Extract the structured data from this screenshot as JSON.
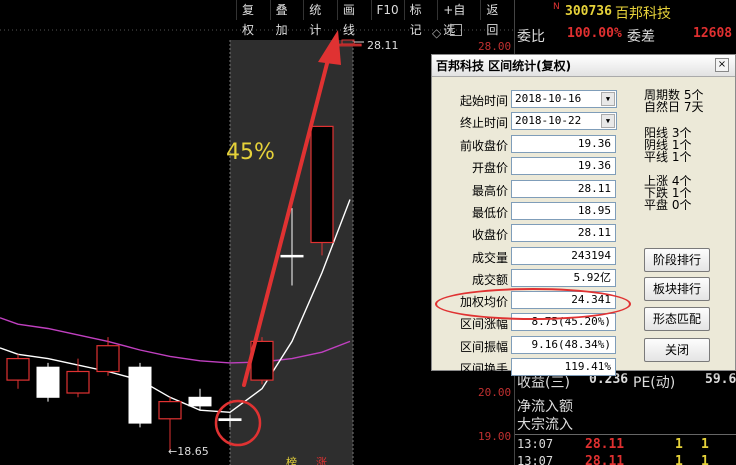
{
  "toolbar": [
    {
      "label": "复权"
    },
    {
      "label": "叠加"
    },
    {
      "label": "统计"
    },
    {
      "label": "画线"
    },
    {
      "label": "F10"
    },
    {
      "label": "标记"
    },
    {
      "label": "+自选"
    },
    {
      "label": "返回"
    }
  ],
  "chart": {
    "price_axis": [
      "28.00",
      "20.00",
      "19.00"
    ],
    "gain_annotation": "45%",
    "high_marker": "28.11",
    "low_marker": "←18.65",
    "bottom_tag_1": "榜",
    "bottom_tag_2": "涨",
    "candles": [
      {
        "open": 20.3,
        "close": 20.8,
        "high": 20.9,
        "low": 20.1,
        "up": true
      },
      {
        "open": 20.6,
        "close": 19.9,
        "high": 20.7,
        "low": 19.8,
        "up": false
      },
      {
        "open": 20.0,
        "close": 20.5,
        "high": 20.8,
        "low": 19.9,
        "up": true
      },
      {
        "open": 20.5,
        "close": 21.1,
        "high": 21.3,
        "low": 20.4,
        "up": true
      },
      {
        "open": 20.6,
        "close": 19.3,
        "high": 20.7,
        "low": 19.2,
        "up": false
      },
      {
        "open": 19.4,
        "close": 19.8,
        "high": 19.9,
        "low": 18.65,
        "up": true
      },
      {
        "open": 19.9,
        "close": 19.7,
        "high": 20.1,
        "low": 19.6,
        "up": false
      },
      {
        "open": 19.4,
        "close": 19.36,
        "high": 19.5,
        "low": 19.2,
        "up": false
      },
      {
        "open": 20.3,
        "close": 21.2,
        "high": 21.3,
        "low": 20.2,
        "up": true
      },
      {
        "open": 23.2,
        "close": 23.2,
        "high": 24.3,
        "low": 22.5,
        "up": false
      },
      {
        "open": 23.5,
        "close": 26.2,
        "high": 26.2,
        "low": 23.2,
        "up": true
      },
      {
        "open": 28.11,
        "close": 28.11,
        "high": 28.11,
        "low": 28.11,
        "up": true
      }
    ],
    "ma_purple": [
      21.6,
      21.5,
      21.35,
      21.2,
      21.0,
      20.85,
      20.75,
      20.7,
      20.72,
      20.8,
      20.95,
      21.2
    ],
    "ma_white": [
      20.9,
      20.8,
      20.65,
      20.5,
      20.3,
      19.9,
      19.6,
      19.55,
      20.1,
      21.2,
      22.8,
      24.5
    ],
    "colors": {
      "up": "#e03232",
      "down": "#ffffff",
      "ma_purple": "#c040c0",
      "arrow": "#e03232"
    }
  },
  "quote": {
    "marker": "N",
    "code": "300736",
    "name": "百邦科技",
    "wb_label": "委比",
    "wb_value": "100.00%",
    "wc_label": "委差",
    "wc_value": "12608",
    "rows": [
      {
        "k": "收益(三)",
        "v1": "0.236",
        "k2": "PE(动)",
        "v2": "59.6"
      },
      {
        "k": "净流入额",
        "v1": "",
        "k2": "",
        "v2": ""
      },
      {
        "k": "大宗流入",
        "v1": "",
        "k2": "",
        "v2": ""
      }
    ],
    "ticks": [
      {
        "time": "13:07",
        "price": "28.11",
        "vol": "1",
        "n": "1"
      },
      {
        "time": "13:07",
        "price": "28.11",
        "vol": "1",
        "n": "1"
      }
    ]
  },
  "dialog": {
    "title": "百邦科技 区间统计(复权)",
    "close": "×",
    "start_label": "起始时间",
    "start_value": "2018-10-16",
    "end_label": "终止时间",
    "end_value": "2018-10-22",
    "fields": [
      {
        "label": "前收盘价",
        "value": "19.36"
      },
      {
        "label": "开盘价",
        "value": "19.36"
      },
      {
        "label": "最高价",
        "value": "28.11"
      },
      {
        "label": "最低价",
        "value": "18.95"
      },
      {
        "label": "收盘价",
        "value": "28.11"
      },
      {
        "label": "成交量",
        "value": "243194"
      },
      {
        "label": "成交额",
        "value": "5.92亿"
      },
      {
        "label": "加权均价",
        "value": "24.341"
      },
      {
        "label": "区间涨幅",
        "value": "8.75(45.20%)"
      },
      {
        "label": "区间振幅",
        "value": "9.16(48.34%)"
      },
      {
        "label": "区间换手",
        "value": "119.41%"
      }
    ],
    "stats": {
      "period_label": "周期数",
      "period_value": "5个",
      "natural_label": "自然日",
      "natural_value": "7天",
      "yang_label": "阳线",
      "yang_value": "3个",
      "yin_label": "阴线",
      "yin_value": "1个",
      "flat_label": "平线",
      "flat_value": "1个",
      "up_label": "上涨",
      "up_value": "4个",
      "down_label": "下跌",
      "down_value": "1个",
      "level_label": "平盘",
      "level_value": "0个"
    },
    "buttons": {
      "rank": "阶段排行",
      "sector": "板块排行",
      "pattern": "形态匹配",
      "close": "关闭"
    }
  }
}
